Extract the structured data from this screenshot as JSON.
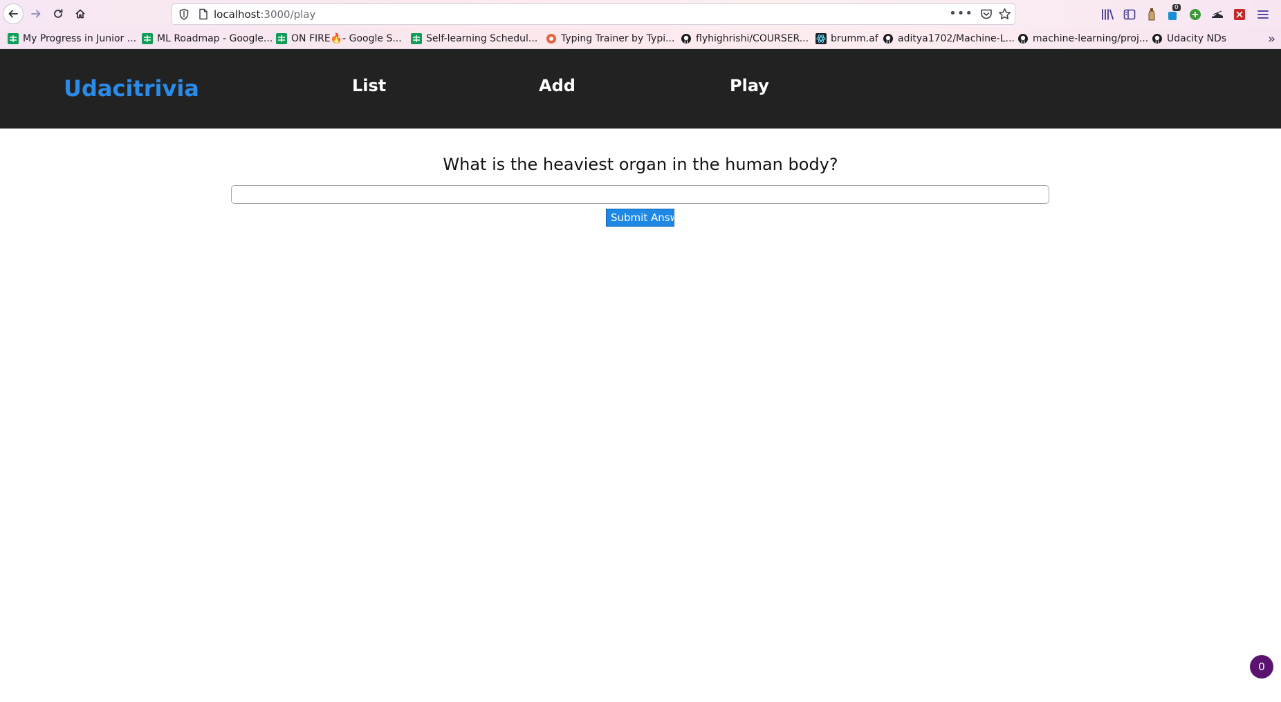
{
  "browser": {
    "url_host": "localhost",
    "url_path": ":3000/play",
    "meatball_label": "•••",
    "extension_badge_count": "0",
    "bookmarks_overflow": "»",
    "bookmarks": [
      {
        "label": "My Progress in Junior ...",
        "icon": "google-sheets-icon"
      },
      {
        "label": "ML Roadmap - Google...",
        "icon": "google-sheets-icon"
      },
      {
        "label": "ON FIRE",
        "label_suffix": " - Google S...",
        "icon": "google-sheets-icon",
        "emoji": "🔥"
      },
      {
        "label": "Self-learning Schedul...",
        "icon": "google-sheets-icon"
      },
      {
        "label": "Typing Trainer by Typi...",
        "icon": "typing-trainer-icon"
      },
      {
        "label": "flyhighrishi/COURSER...",
        "icon": "github-icon"
      },
      {
        "label": "brumm.af",
        "icon": "react-icon"
      },
      {
        "label": "aditya1702/Machine-L...",
        "icon": "github-icon"
      },
      {
        "label": "machine-learning/proj...",
        "icon": "github-icon"
      },
      {
        "label": "Udacity NDs",
        "icon": "github-icon"
      }
    ]
  },
  "app": {
    "brand": "Udacitrivia",
    "nav": [
      "List",
      "Add",
      "Play"
    ],
    "brand_color": "#2a8ce8",
    "header_bg": "#222222"
  },
  "quiz": {
    "question": "What is the heaviest organ in the human body?",
    "answer_value": "",
    "answer_placeholder": "",
    "submit_label": "Submit Answer",
    "button_color": "#1e88e5"
  },
  "corner_badge": "0"
}
